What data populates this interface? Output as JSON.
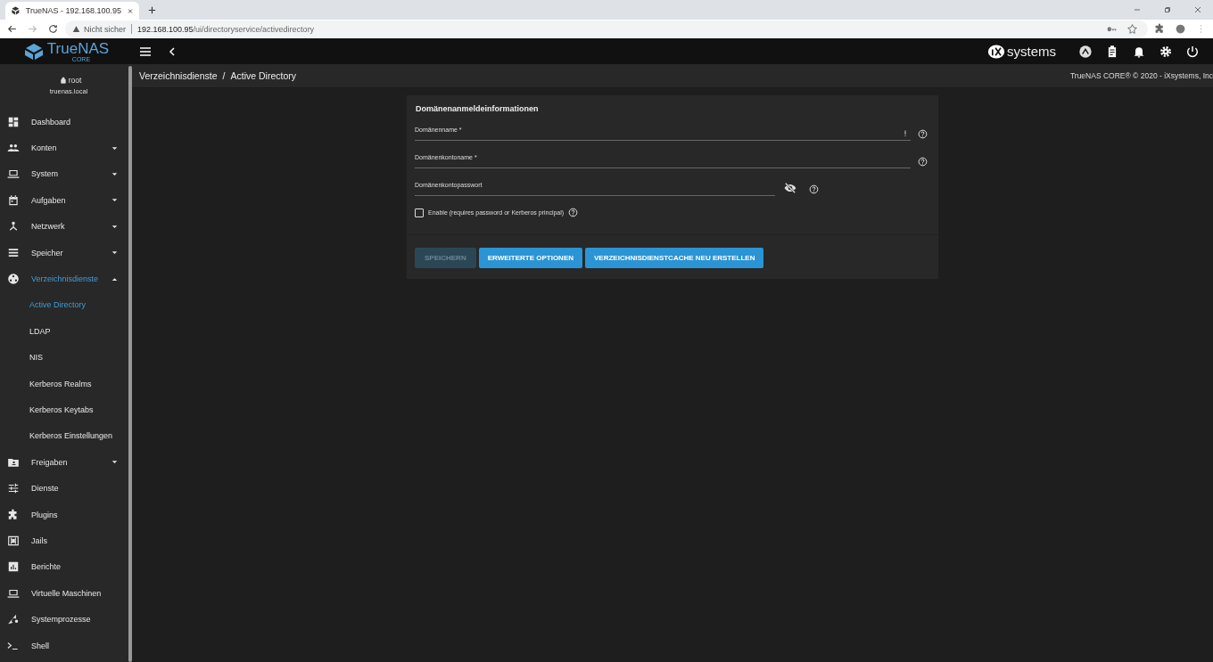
{
  "browser": {
    "tab_title": "TrueNAS - 192.168.100.95",
    "security": "Nicht sicher",
    "url_host": "192.168.100.95",
    "url_path": "/ui/directoryservice/activedirectory"
  },
  "header": {
    "logo": "TrueNAS",
    "logo_sub": "CORE",
    "vendor": "systems"
  },
  "breadcrumb": {
    "items": [
      "Verzeichnisdienste",
      "Active Directory"
    ],
    "separator": "/",
    "copyright": "TrueNAS CORE® © 2020 - iXsystems, Inc"
  },
  "sidebar": {
    "user": "root",
    "host": "truenas.local",
    "items": [
      {
        "label": "Dashboard",
        "selected": false
      },
      {
        "label": "Konten",
        "selected": false,
        "expanded": false
      },
      {
        "label": "System",
        "selected": false,
        "expanded": false
      },
      {
        "label": "Aufgaben",
        "selected": false,
        "expanded": false
      },
      {
        "label": "Netzwerk",
        "selected": false,
        "expanded": false
      },
      {
        "label": "Speicher",
        "selected": false,
        "expanded": false
      },
      {
        "label": "Verzeichnisdienste",
        "selected": true,
        "expanded": true,
        "children": [
          {
            "label": "Active Directory",
            "selected": true
          },
          {
            "label": "LDAP",
            "selected": false
          },
          {
            "label": "NIS",
            "selected": false
          },
          {
            "label": "Kerberos Realms",
            "selected": false
          },
          {
            "label": "Kerberos Keytabs",
            "selected": false
          },
          {
            "label": "Kerberos Einstellungen",
            "selected": false
          }
        ]
      },
      {
        "label": "Freigaben",
        "selected": false,
        "expanded": false
      },
      {
        "label": "Dienste",
        "selected": false
      },
      {
        "label": "Plugins",
        "selected": false
      },
      {
        "label": "Jails",
        "selected": false
      },
      {
        "label": "Berichte",
        "selected": false
      },
      {
        "label": "Virtuelle Maschinen",
        "selected": false
      },
      {
        "label": "Systemprozesse",
        "selected": false
      },
      {
        "label": "Shell",
        "selected": false
      }
    ]
  },
  "form": {
    "title": "Domänenanmeldeinformationen",
    "fields": [
      {
        "label": "Domänenname *",
        "kind": "text",
        "error": true
      },
      {
        "label": "Domänenkontoname *",
        "kind": "text",
        "error": false
      },
      {
        "label": "Domänenkontopasswort",
        "kind": "password",
        "error": false
      }
    ],
    "checkbox": {
      "label": "Enable (requires password or Kerberos principal)",
      "checked": false
    },
    "buttons": [
      {
        "label": "SPEICHERN",
        "disabled": true
      },
      {
        "label": "ERWEITERTE OPTIONEN",
        "disabled": false
      },
      {
        "label": "VERZEICHNISDIENSTCACHE NEU ERSTELLEN",
        "disabled": false
      }
    ]
  }
}
